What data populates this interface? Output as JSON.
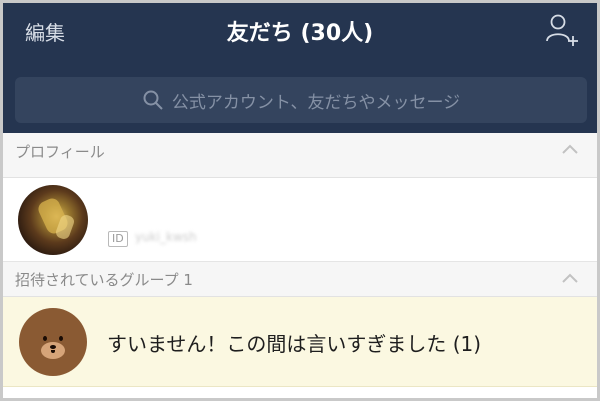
{
  "header": {
    "left_label": "編集",
    "title": "友だち (30人)",
    "right_icon": "add-friend-icon"
  },
  "search": {
    "placeholder": "公式アカウント、友だちやメッセージ",
    "icon": "search-icon"
  },
  "sections": {
    "profile": {
      "label": "プロフィール",
      "id_badge": "ID",
      "id_value": "yuki_kwsh"
    },
    "invited_groups": {
      "label": "招待されているグループ 1",
      "items": [
        {
          "name": "すいません！この間は言いすぎました (1)",
          "avatar": "bear-avatar"
        }
      ]
    }
  },
  "colors": {
    "navbar": "#253550",
    "search_bg": "#34445e",
    "section_bg": "#f6f6f6",
    "highlight_row": "#fbf8e1"
  }
}
